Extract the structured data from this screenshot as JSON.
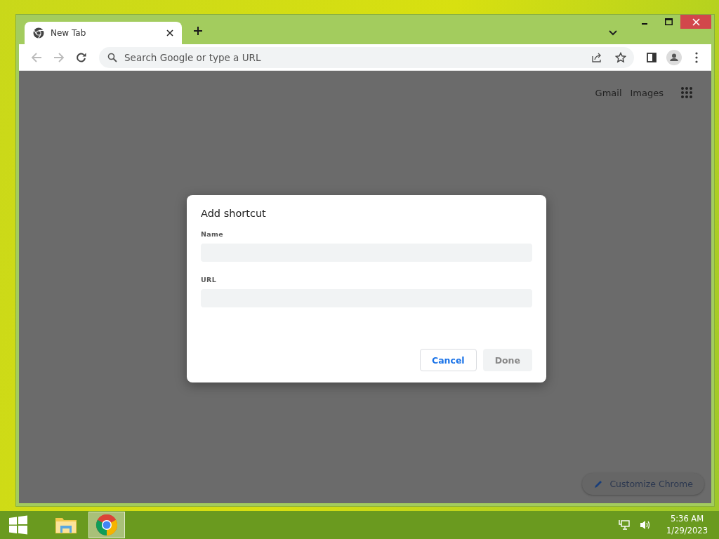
{
  "tabs": [
    {
      "title": "New Tab",
      "selected": true
    }
  ],
  "toolbar": {
    "back_disabled": true,
    "forward_disabled": true,
    "address_placeholder": "Search Google or type a URL"
  },
  "page": {
    "links": [
      "Gmail",
      "Images"
    ],
    "customize_button": "Customize Chrome"
  },
  "dialog": {
    "title": "Add shortcut",
    "fields": [
      {
        "label": "Name"
      },
      {
        "label": "URL"
      }
    ],
    "buttons": [
      {
        "label": "Cancel",
        "disabled": false
      },
      {
        "label": "Done",
        "disabled": true
      }
    ]
  },
  "taskbar": {
    "apps": [
      {
        "kind": "explorer",
        "active": false
      },
      {
        "kind": "chrome",
        "active": true
      }
    ],
    "time": "5:36 AM",
    "date": "1/29/2023"
  }
}
